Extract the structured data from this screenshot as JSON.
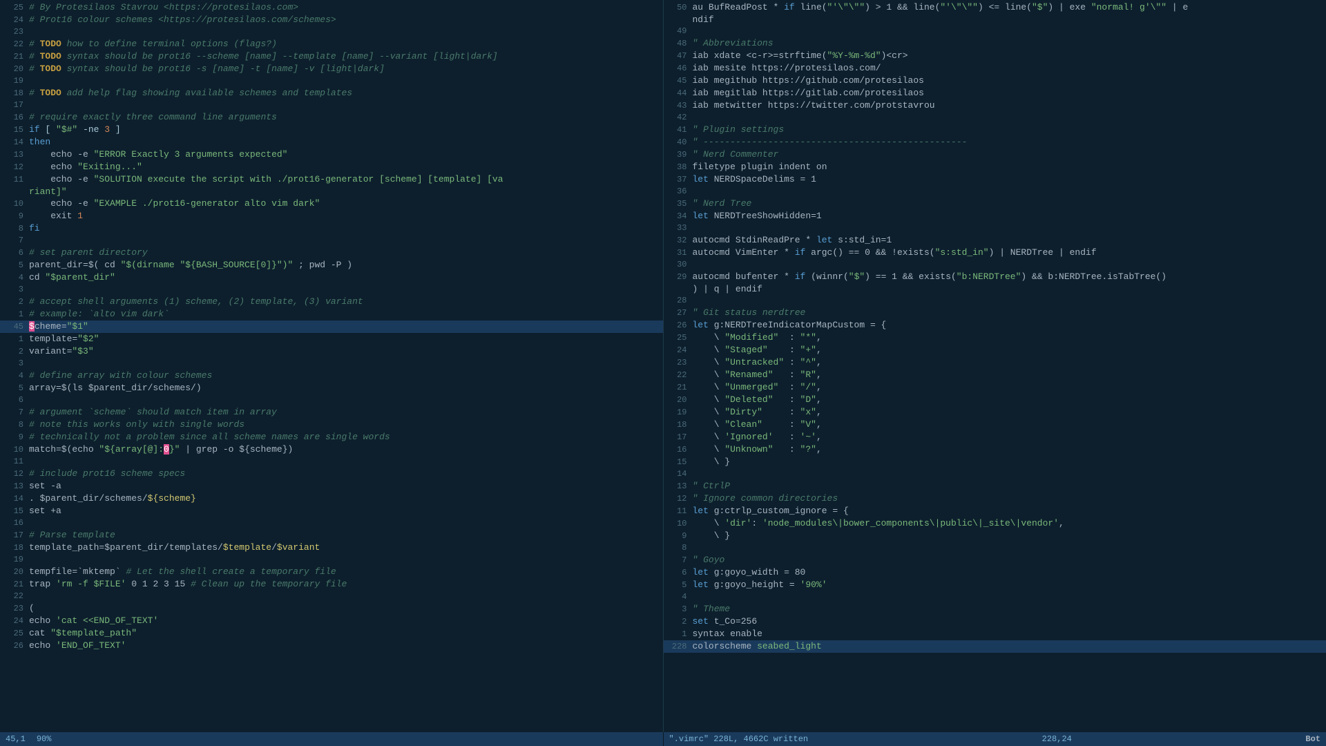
{
  "left_pane": {
    "lines": [
      {
        "num": "25",
        "content": "# By Protesilaos Stavrou <https://protesilaos.com>",
        "type": "comment"
      },
      {
        "num": "24",
        "content": "# Prot16 colour schemes <https://protesilaos.com/schemes>",
        "type": "comment"
      },
      {
        "num": "23",
        "content": "",
        "type": "blank"
      },
      {
        "num": "22",
        "content": "# TODO how to define terminal options (flags?)",
        "type": "comment-todo"
      },
      {
        "num": "21",
        "content": "# TODO syntax should be prot16 --scheme [name] --template [name] --variant [light|dark]",
        "type": "comment-todo"
      },
      {
        "num": "20",
        "content": "# TODO syntax should be prot16 -s [name] -t [name] -v [light|dark]",
        "type": "comment-todo"
      },
      {
        "num": "19",
        "content": "",
        "type": "blank"
      },
      {
        "num": "18",
        "content": "# TODO add help flag showing available schemes and templates",
        "type": "comment-todo"
      },
      {
        "num": "17",
        "content": "",
        "type": "blank"
      },
      {
        "num": "16",
        "content": "# require exactly three command line arguments",
        "type": "comment"
      },
      {
        "num": "15",
        "content": "if [ \"$#\" -ne 3 ]",
        "type": "code"
      },
      {
        "num": "14",
        "content": "then",
        "type": "keyword"
      },
      {
        "num": "13",
        "content": "    echo -e \"ERROR Exactly 3 arguments expected\"",
        "type": "code"
      },
      {
        "num": "12",
        "content": "    echo \"Exiting...\"",
        "type": "code"
      },
      {
        "num": "11",
        "content": "    echo -e \"SOLUTION execute the script with ./prot16-generator [scheme] [template] [va",
        "type": "code"
      },
      {
        "num": "",
        "content": "riant]\"",
        "type": "code-cont"
      },
      {
        "num": "10",
        "content": "    echo -e \"EXAMPLE ./prot16-generator alto vim dark\"",
        "type": "code"
      },
      {
        "num": "9",
        "content": "    exit 1",
        "type": "code"
      },
      {
        "num": "8",
        "content": "fi",
        "type": "keyword"
      },
      {
        "num": "7",
        "content": "",
        "type": "blank"
      },
      {
        "num": "6",
        "content": "# set parent directory",
        "type": "comment"
      },
      {
        "num": "5",
        "content": "parent_dir=$( cd \"$(dirname \"${BASH_SOURCE[0]}\")\" ; pwd -P )",
        "type": "code"
      },
      {
        "num": "4",
        "content": "cd \"$parent_dir\"",
        "type": "code"
      },
      {
        "num": "3",
        "content": "",
        "type": "blank"
      },
      {
        "num": "2",
        "content": "# accept shell arguments (1) scheme, (2) template, (3) variant",
        "type": "comment"
      },
      {
        "num": "1",
        "content": "# example: `alto vim dark`",
        "type": "comment"
      },
      {
        "num": "45",
        "content": "scheme=\"$1\"",
        "type": "code",
        "highlighted": true
      },
      {
        "num": "1",
        "content": "template=\"$2\"",
        "type": "code"
      },
      {
        "num": "2",
        "content": "variant=\"$3\"",
        "type": "code"
      },
      {
        "num": "3",
        "content": "",
        "type": "blank"
      },
      {
        "num": "4",
        "content": "# define array with colour schemes",
        "type": "comment"
      },
      {
        "num": "5",
        "content": "array=$(ls $parent_dir/schemes/)",
        "type": "code"
      },
      {
        "num": "6",
        "content": "",
        "type": "blank"
      },
      {
        "num": "7",
        "content": "# argument `scheme` should match item in array",
        "type": "comment"
      },
      {
        "num": "8",
        "content": "# note this works only with single words",
        "type": "comment"
      },
      {
        "num": "9",
        "content": "# technically not a problem since all scheme names are single words",
        "type": "comment"
      },
      {
        "num": "10",
        "content": "match=$(echo \"${array[@]:0}\" | grep -o ${scheme})",
        "type": "code"
      },
      {
        "num": "11",
        "content": "",
        "type": "blank"
      },
      {
        "num": "12",
        "content": "# include prot16 scheme specs",
        "type": "comment"
      },
      {
        "num": "13",
        "content": "set -a",
        "type": "code"
      },
      {
        "num": "14",
        "content": ". $parent_dir/schemes/${scheme}",
        "type": "code"
      },
      {
        "num": "15",
        "content": "set +a",
        "type": "code"
      },
      {
        "num": "16",
        "content": "",
        "type": "blank"
      },
      {
        "num": "17",
        "content": "# Parse template",
        "type": "comment"
      },
      {
        "num": "18",
        "content": "template_path=$parent_dir/templates/$template/$variant",
        "type": "code"
      },
      {
        "num": "19",
        "content": "",
        "type": "blank"
      },
      {
        "num": "20",
        "content": "tempfile=`mktemp` # Let the shell create a temporary file",
        "type": "code"
      },
      {
        "num": "21",
        "content": "trap 'rm -f $FILE' 0 1 2 3 15 # Clean up the temporary file",
        "type": "code"
      },
      {
        "num": "22",
        "content": "",
        "type": "blank"
      },
      {
        "num": "23",
        "content": "(",
        "type": "code"
      },
      {
        "num": "24",
        "content": "echo 'cat <<END_OF_TEXT'",
        "type": "code"
      },
      {
        "num": "25",
        "content": "cat \"$template_path\"",
        "type": "code"
      },
      {
        "num": "26",
        "content": "echo 'END_OF_TEXT'",
        "type": "code"
      }
    ],
    "status": {
      "position": "45,1",
      "percent": "90%"
    }
  },
  "right_pane": {
    "lines": [
      {
        "num": "50",
        "content": "au BufReadPost * if line(\"'\\\"\\\"'\") > 1 && line(\"'\\\"\\\"'\") <= line(\"$\") | exe \"normal! g'\\\"\" | e",
        "type": "code"
      },
      {
        "num": "",
        "content": "ndif",
        "type": "code-cont"
      },
      {
        "num": "49",
        "content": "",
        "type": "blank"
      },
      {
        "num": "48",
        "content": "\" Abbreviations",
        "type": "vim-comment"
      },
      {
        "num": "47",
        "content": "iab xdate <c-r>=strftime(\"%Y-%m-%d\")<cr>",
        "type": "code"
      },
      {
        "num": "46",
        "content": "iab mesite https://protesilaos.com/",
        "type": "code"
      },
      {
        "num": "45",
        "content": "iab megithub https://github.com/protesilaos",
        "type": "code"
      },
      {
        "num": "44",
        "content": "iab megitlab https://gitlab.com/protesilaos",
        "type": "code"
      },
      {
        "num": "43",
        "content": "iab metwitter https://twitter.com/protstavrou",
        "type": "code"
      },
      {
        "num": "42",
        "content": "",
        "type": "blank"
      },
      {
        "num": "41",
        "content": "\" Plugin settings",
        "type": "vim-comment"
      },
      {
        "num": "40",
        "content": "\" -------------------------------------------------",
        "type": "vim-comment"
      },
      {
        "num": "39",
        "content": "\" Nerd Commenter",
        "type": "vim-comment"
      },
      {
        "num": "38",
        "content": "filetype plugin indent on",
        "type": "code"
      },
      {
        "num": "37",
        "content": "let NERDSpaceDelims = 1",
        "type": "code"
      },
      {
        "num": "36",
        "content": "",
        "type": "blank"
      },
      {
        "num": "35",
        "content": "\" Nerd Tree",
        "type": "vim-comment"
      },
      {
        "num": "34",
        "content": "let NERDTreeShowHidden=1",
        "type": "code"
      },
      {
        "num": "33",
        "content": "",
        "type": "blank"
      },
      {
        "num": "32",
        "content": "autocmd StdinReadPre * let s:std_in=1",
        "type": "code"
      },
      {
        "num": "31",
        "content": "autocmd VimEnter * if argc() == 0 && !exists(\"s:std_in\") | NERDTree | endif",
        "type": "code"
      },
      {
        "num": "30",
        "content": "",
        "type": "blank"
      },
      {
        "num": "29",
        "content": "autocmd bufenter * if (winnr(\"$\") == 1 && exists(\"b:NERDTree\") && b:NERDTree.isTabTree()",
        "type": "code"
      },
      {
        "num": "",
        "content": ") | q | endif",
        "type": "code-cont"
      },
      {
        "num": "28",
        "content": "",
        "type": "blank"
      },
      {
        "num": "27",
        "content": "\" Git status nerdtree",
        "type": "vim-comment"
      },
      {
        "num": "26",
        "content": "let g:NERDTreeIndicatorMapCustom = {",
        "type": "code"
      },
      {
        "num": "25",
        "content": "    \\ \"Modified\"  : \"*\",",
        "type": "code"
      },
      {
        "num": "24",
        "content": "    \\ \"Staged\"    : \"+\",",
        "type": "code"
      },
      {
        "num": "23",
        "content": "    \\ \"Untracked\" : \"^\",",
        "type": "code"
      },
      {
        "num": "22",
        "content": "    \\ \"Renamed\"   : \"R\",",
        "type": "code"
      },
      {
        "num": "21",
        "content": "    \\ \"Unmerged\"  : \"/\",",
        "type": "code"
      },
      {
        "num": "20",
        "content": "    \\ \"Deleted\"   : \"D\",",
        "type": "code"
      },
      {
        "num": "19",
        "content": "    \\ \"Dirty\"     : \"x\",",
        "type": "code"
      },
      {
        "num": "18",
        "content": "    \\ \"Clean\"     : \"V\",",
        "type": "code"
      },
      {
        "num": "17",
        "content": "    \\ 'Ignored'   : '~',",
        "type": "code"
      },
      {
        "num": "16",
        "content": "    \\ \"Unknown\"   : \"?\",",
        "type": "code"
      },
      {
        "num": "15",
        "content": "    \\ }",
        "type": "code"
      },
      {
        "num": "14",
        "content": "",
        "type": "blank"
      },
      {
        "num": "13",
        "content": "\" CtrlP",
        "type": "vim-comment"
      },
      {
        "num": "12",
        "content": "\" Ignore common directories",
        "type": "vim-comment"
      },
      {
        "num": "11",
        "content": "let g:ctrlp_custom_ignore = {",
        "type": "code"
      },
      {
        "num": "10",
        "content": "    \\ 'dir': 'node_modules\\|bower_components\\|public\\|_site\\|vendor',",
        "type": "code"
      },
      {
        "num": "9",
        "content": "    \\ }",
        "type": "code"
      },
      {
        "num": "8",
        "content": "",
        "type": "blank"
      },
      {
        "num": "7",
        "content": "\" Goyo",
        "type": "vim-comment"
      },
      {
        "num": "6",
        "content": "let g:goyo_width = 80",
        "type": "code"
      },
      {
        "num": "5",
        "content": "let g:goyo_height = '90%'",
        "type": "code"
      },
      {
        "num": "4",
        "content": "",
        "type": "blank"
      },
      {
        "num": "3",
        "content": "\" Theme",
        "type": "vim-comment"
      },
      {
        "num": "2",
        "content": "set t_Co=256",
        "type": "code"
      },
      {
        "num": "1",
        "content": "syntax enable",
        "type": "code"
      },
      {
        "num": "228",
        "content": "colorscheme seabed_light",
        "type": "colorscheme",
        "highlighted": true
      }
    ],
    "status": {
      "file": "\".vimrc\" 228L, 4662C written",
      "position": "228,24",
      "mode": "Bot"
    }
  }
}
